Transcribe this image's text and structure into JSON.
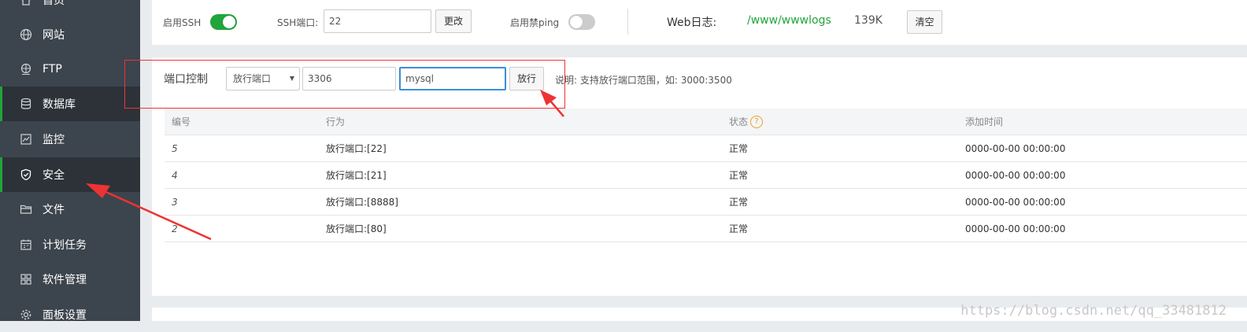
{
  "sidebar": {
    "items": [
      {
        "label": "首页",
        "icon": "home-icon"
      },
      {
        "label": "网站",
        "icon": "globe-icon"
      },
      {
        "label": "FTP",
        "icon": "ftp-icon"
      },
      {
        "label": "数据库",
        "icon": "database-icon"
      },
      {
        "label": "监控",
        "icon": "monitor-icon"
      },
      {
        "label": "安全",
        "icon": "shield-icon"
      },
      {
        "label": "文件",
        "icon": "folder-icon"
      },
      {
        "label": "计划任务",
        "icon": "calendar-icon"
      },
      {
        "label": "软件管理",
        "icon": "grid-icon"
      },
      {
        "label": "面板设置",
        "icon": "gear-icon"
      }
    ],
    "active_item": "安全",
    "accent": "#20a53a"
  },
  "settings": {
    "ssh_label": "启用SSH",
    "ssh_enabled": true,
    "ssh_port_label": "SSH端口:",
    "ssh_port_value": "22",
    "change_button": "更改",
    "ping_label": "启用禁ping",
    "ping_enabled": false,
    "web_log_label": "Web日志:",
    "web_log_path": "/www/wwwlogs",
    "web_log_size": "139K",
    "clear_button": "清空"
  },
  "port_control": {
    "title": "端口控制",
    "action_select": "放行端口",
    "port_value": "3306",
    "remark_value": "mysql",
    "submit_button": "放行",
    "hint": "说明: 支持放行端口范围，如: 3000:3500"
  },
  "table": {
    "headers": [
      "编号",
      "行为",
      "状态",
      "添加时间"
    ],
    "rows": [
      {
        "id": "5",
        "action": "放行端口:[22]",
        "status": "正常",
        "time": "0000-00-00 00:00:00"
      },
      {
        "id": "4",
        "action": "放行端口:[21]",
        "status": "正常",
        "time": "0000-00-00 00:00:00"
      },
      {
        "id": "3",
        "action": "放行端口:[8888]",
        "status": "正常",
        "time": "0000-00-00 00:00:00"
      },
      {
        "id": "2",
        "action": "放行端口:[80]",
        "status": "正常",
        "time": "0000-00-00 00:00:00"
      }
    ]
  },
  "watermark": "https://blog.csdn.net/qq_33481812",
  "colors": {
    "green": "#20a53a",
    "annotation": "#e33333",
    "sidebar_bg": "#3c444d"
  }
}
